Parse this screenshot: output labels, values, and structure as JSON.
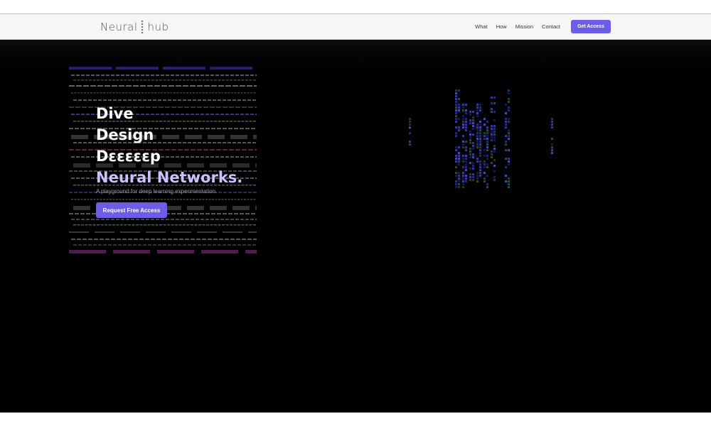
{
  "header": {
    "logo": {
      "left": "Neural",
      "right": "hub"
    },
    "nav": [
      "What",
      "How",
      "Mission",
      "Contact"
    ],
    "cta_label": "Get Access"
  },
  "hero": {
    "lines": [
      "Dive",
      "Design",
      "Dεεεεεp"
    ],
    "accent_line": "Neural Networks.",
    "subtitle": "A playground for deep learning experimentation.",
    "button_label": "Request Free Access"
  },
  "colors": {
    "accent": "#6c5ce7",
    "accent_light": "#c7c3ff",
    "background": "#000000",
    "nav_background": "#f6f6f6"
  },
  "icons": [
    "logo-dots-icon"
  ]
}
